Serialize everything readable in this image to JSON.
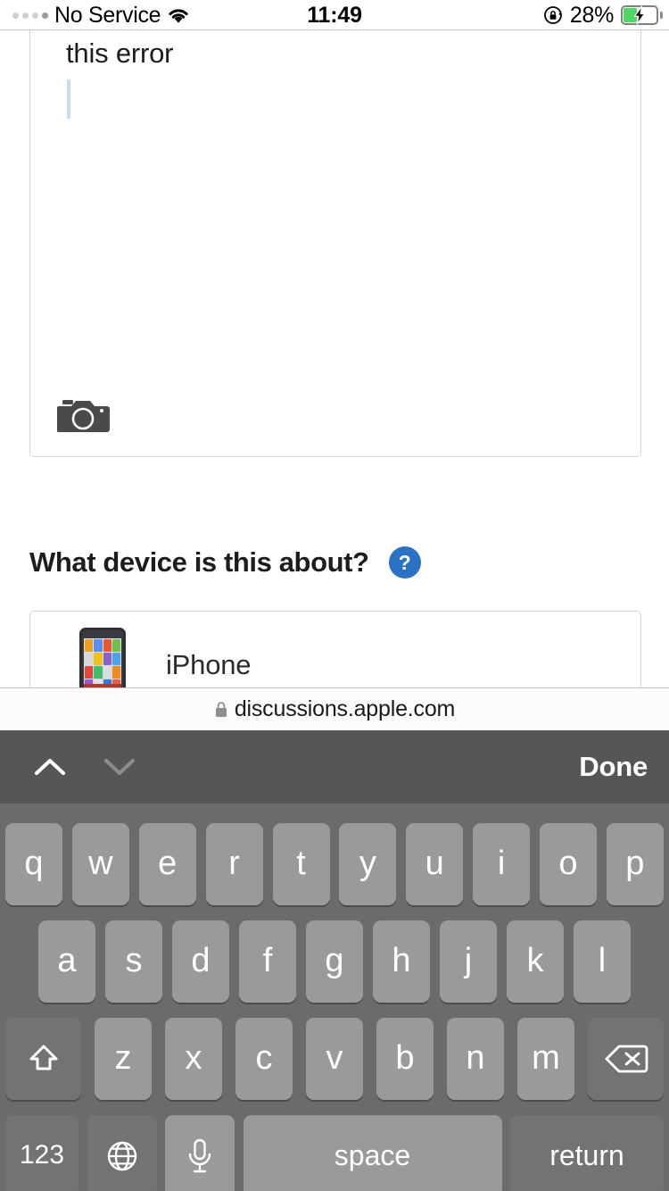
{
  "status_bar": {
    "carrier": "No Service",
    "wifi_icon": "wifi-icon",
    "time": "11:49",
    "rotation_lock_icon": "rotation-lock-icon",
    "battery_percent": "28%",
    "battery_icon": "battery-charging-icon",
    "battery_level": 28,
    "battery_color": "#4cd863",
    "signal_dots": 4
  },
  "content": {
    "textarea": {
      "value": "this error",
      "caret_visible": true,
      "camera_icon": "camera-icon"
    },
    "device_question": {
      "label": "What device is this about?",
      "help_badge": "?",
      "help_badge_color": "#2b72c4"
    },
    "device_option": {
      "label": "iPhone",
      "thumbnail_icon": "iphone-thumbnail-icon"
    }
  },
  "url_bar": {
    "lock_icon": "lock-icon",
    "url": "discussions.apple.com"
  },
  "keyboard": {
    "toolbar": {
      "prev_icon": "chevron-up-icon",
      "next_icon": "chevron-down-icon",
      "prev_enabled": true,
      "next_enabled": false,
      "done_label": "Done"
    },
    "background_color": "#6b6b6b",
    "toolbar_color": "#565656",
    "key_color": "#9a9a9a",
    "modifier_key_color": "#737373",
    "row1": [
      "q",
      "w",
      "e",
      "r",
      "t",
      "y",
      "u",
      "i",
      "o",
      "p"
    ],
    "row2": [
      "a",
      "s",
      "d",
      "f",
      "g",
      "h",
      "j",
      "k",
      "l"
    ],
    "row3_letters": [
      "z",
      "x",
      "c",
      "v",
      "b",
      "n",
      "m"
    ],
    "shift_icon": "shift-icon",
    "backspace_icon": "backspace-icon",
    "row4": {
      "numbers_label": "123",
      "globe_icon": "globe-icon",
      "mic_icon": "microphone-icon",
      "space_label": "space",
      "return_label": "return"
    }
  }
}
